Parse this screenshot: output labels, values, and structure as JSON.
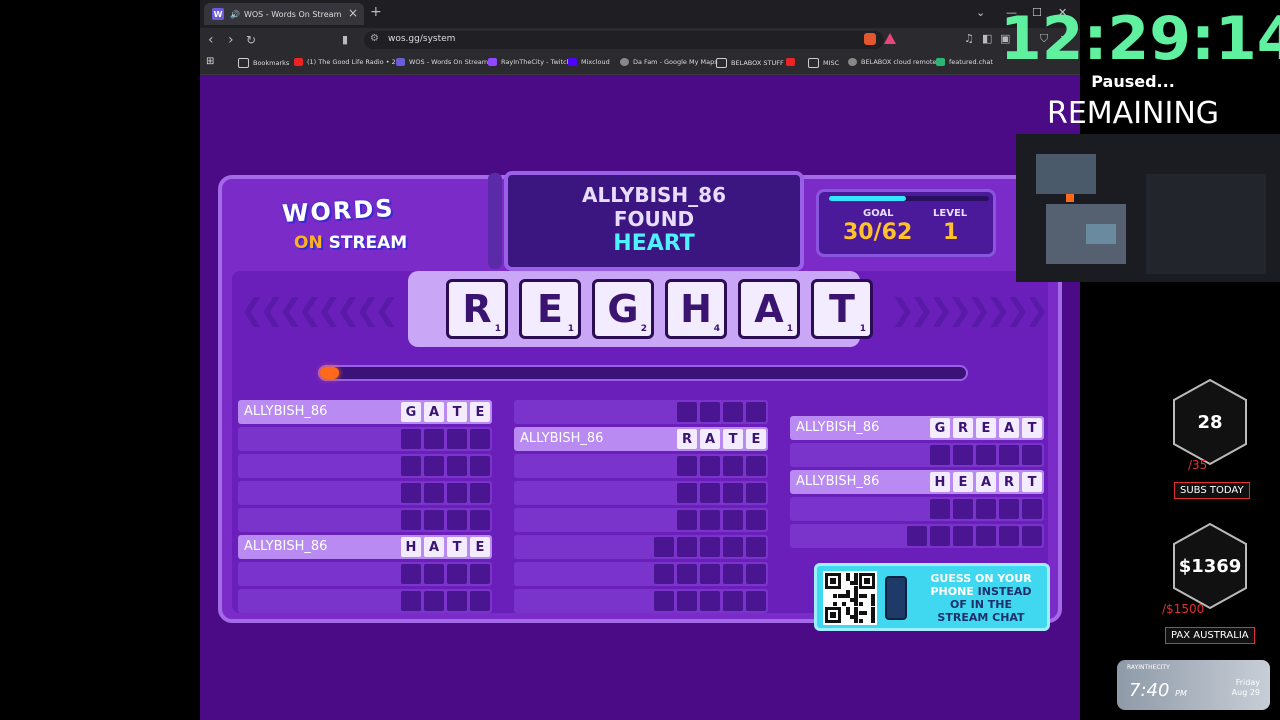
{
  "browser": {
    "tab_title": "WOS - Words On Stream",
    "tab_favicon": "W",
    "url": "wos.gg/system",
    "bookmarks": [
      "Bookmarks",
      "(1) The Good Life Radio • 2...",
      "WOS - Words On Stream",
      "RayInTheCity - Twitch",
      "Mixcloud",
      "Da Fam - Google My Maps",
      "BELABOX STUFF",
      "MISC",
      "BELABOX cloud remote",
      "featured.chat"
    ]
  },
  "game": {
    "logo_top": "WORDS",
    "logo_on": "ON",
    "logo_bottom": "STREAM",
    "found_name": "ALLYBISH_86",
    "found_label": "FOUND",
    "found_word": "HEART",
    "goal_label": "GOAL",
    "goal_value": "30/62",
    "goal_progress": 0.48,
    "level_label": "LEVEL",
    "level_value": "1",
    "timer_progress": 0.03,
    "tiles": [
      {
        "letter": "R",
        "points": "1"
      },
      {
        "letter": "E",
        "points": "1"
      },
      {
        "letter": "G",
        "points": "2"
      },
      {
        "letter": "H",
        "points": "4"
      },
      {
        "letter": "A",
        "points": "1"
      },
      {
        "letter": "T",
        "points": "1"
      }
    ],
    "columns": [
      [
        {
          "name": "ALLYBISH_86",
          "word": "GATE",
          "len": 4
        },
        {
          "name": "",
          "word": "",
          "len": 4
        },
        {
          "name": "",
          "word": "",
          "len": 4
        },
        {
          "name": "",
          "word": "",
          "len": 4
        },
        {
          "name": "",
          "word": "",
          "len": 4
        },
        {
          "name": "ALLYBISH_86",
          "word": "HATE",
          "len": 4
        },
        {
          "name": "",
          "word": "",
          "len": 4
        },
        {
          "name": "",
          "word": "",
          "len": 4
        }
      ],
      [
        {
          "name": "",
          "word": "",
          "len": 4
        },
        {
          "name": "ALLYBISH_86",
          "word": "RATE",
          "len": 4
        },
        {
          "name": "",
          "word": "",
          "len": 4
        },
        {
          "name": "",
          "word": "",
          "len": 4
        },
        {
          "name": "",
          "word": "",
          "len": 4
        },
        {
          "name": "",
          "word": "",
          "len": 5
        },
        {
          "name": "",
          "word": "",
          "len": 5
        },
        {
          "name": "",
          "word": "",
          "len": 5
        }
      ],
      [
        {
          "name": "ALLYBISH_86",
          "word": "GREAT",
          "len": 5
        },
        {
          "name": "",
          "word": "",
          "len": 5
        },
        {
          "name": "ALLYBISH_86",
          "word": "HEART",
          "len": 5
        },
        {
          "name": "",
          "word": "",
          "len": 5
        },
        {
          "name": "",
          "word": "",
          "len": 6
        }
      ]
    ],
    "qr_text_1": "GUESS ON YOUR",
    "qr_text_2": "PHONE",
    "qr_text_3": "INSTEAD",
    "qr_text_4": "OF IN THE",
    "qr_text_5": "STREAM CHAT"
  },
  "overlay": {
    "clock": "12:29:14",
    "paused": "Paused...",
    "remaining": "REMAINING",
    "subs_count": "28",
    "subs_goal": "/35",
    "subs_label": "SUBS TODAY",
    "money": "$1369",
    "money_goal": "/$1500",
    "money_label": "PAX AUSTRALIA",
    "widget_brand": "RAYINTHECITY",
    "widget_time": "7:40",
    "widget_ampm": "PM",
    "widget_day": "Friday",
    "widget_date": "Aug 29"
  },
  "colors": {
    "accent_green": "#5ff0a0",
    "board_purple": "#7b2cc8",
    "found_cyan": "#4ff0ff",
    "goal_gold": "#ffc22a",
    "badge_red": "#e03030"
  }
}
